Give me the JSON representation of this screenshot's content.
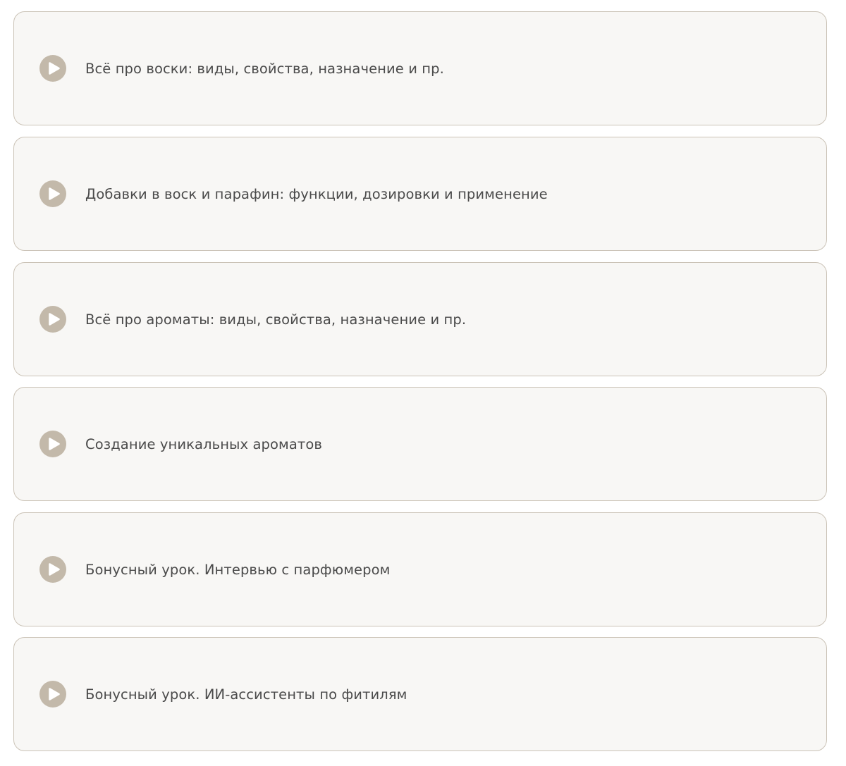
{
  "lessons": [
    {
      "title": "Всё про воски: виды, свойства, назначение и пр.",
      "icon": "play-icon"
    },
    {
      "title": "Добавки в воск и парафин: функции, дозировки и применение",
      "icon": "play-icon"
    },
    {
      "title": "Всё про ароматы: виды, свойства, назначение и пр.",
      "icon": "play-icon"
    },
    {
      "title": "Создание уникальных ароматов",
      "icon": "play-icon"
    },
    {
      "title": "Бонусный урок. Интервью с парфюмером",
      "icon": "play-icon"
    },
    {
      "title": "Бонусный урок. ИИ-ассистенты по фитилям",
      "icon": "play-icon"
    }
  ],
  "colors": {
    "card_background": "#f8f7f5",
    "card_border": "#cbc3b7",
    "icon": "#c3b9aa",
    "text": "#4a4a4a"
  }
}
